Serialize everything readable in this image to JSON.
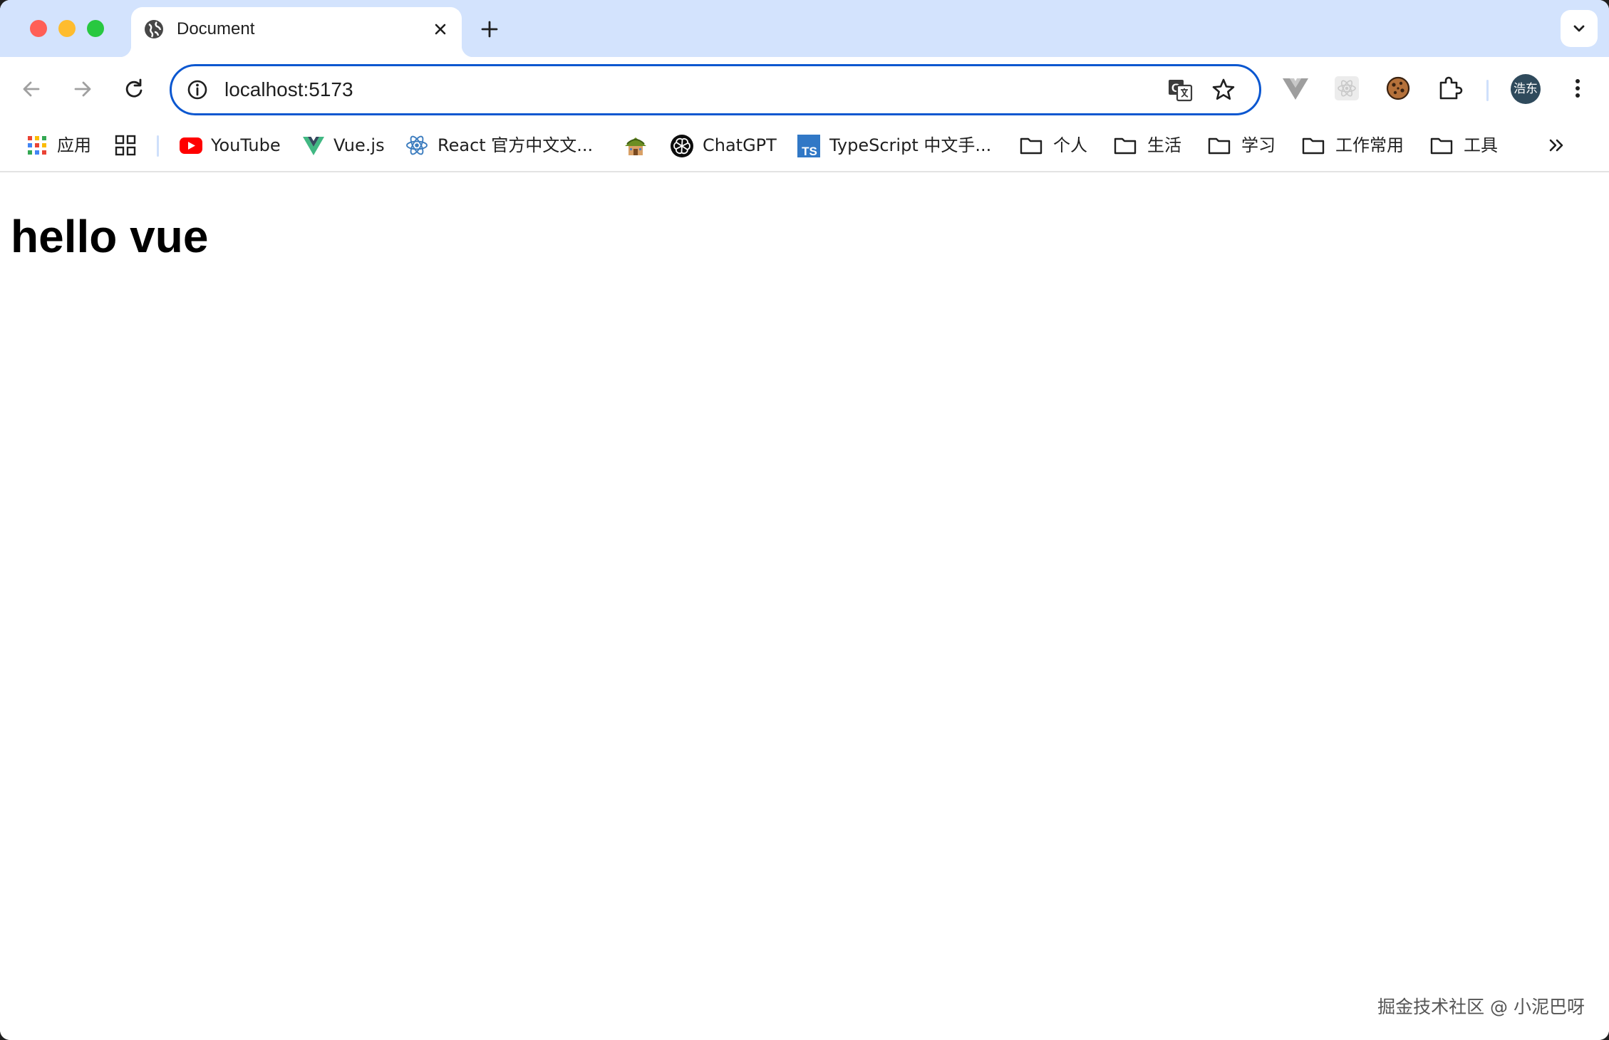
{
  "browser": {
    "tab": {
      "title": "Document",
      "favicon": "globe-icon"
    },
    "address_bar": {
      "url": "localhost:5173"
    },
    "profile": {
      "avatar_text": "浩东"
    },
    "colors": {
      "tab_strip": "#d3e3fd",
      "focus_ring": "#0b57d0"
    }
  },
  "bookmarks": [
    {
      "label": "应用",
      "icon": "apps-grid-icon"
    },
    {
      "label": "",
      "icon": "tab-groups-icon"
    },
    {
      "label": "YouTube",
      "icon": "youtube-icon"
    },
    {
      "label": "Vue.js",
      "icon": "vue-icon"
    },
    {
      "label": "React 官方中文文...",
      "icon": "react-icon"
    },
    {
      "label": "",
      "icon": "hut-icon"
    },
    {
      "label": "ChatGPT",
      "icon": "chatgpt-icon"
    },
    {
      "label": "TypeScript 中文手...",
      "icon": "typescript-icon"
    },
    {
      "label": "个人",
      "icon": "folder-icon"
    },
    {
      "label": "生活",
      "icon": "folder-icon"
    },
    {
      "label": "学习",
      "icon": "folder-icon"
    },
    {
      "label": "工作常用",
      "icon": "folder-icon"
    },
    {
      "label": "工具",
      "icon": "folder-icon"
    }
  ],
  "page": {
    "heading": "hello vue",
    "watermark": "掘金技术社区 @ 小泥巴呀"
  }
}
